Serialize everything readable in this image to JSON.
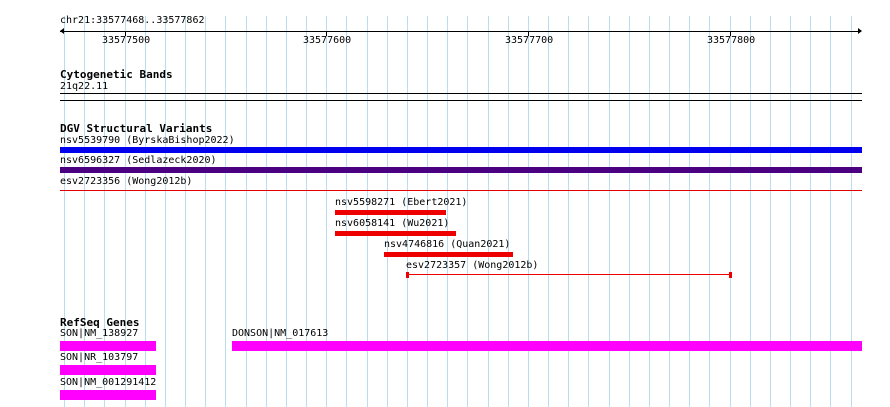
{
  "region": "chr21:33577468..33577862",
  "ruler": {
    "ticks": [
      "33577500",
      "33577600",
      "33577700",
      "33577800"
    ]
  },
  "tracks": {
    "cytoband": {
      "title": "Cytogenetic Bands",
      "band": "21q22.11"
    },
    "dgv": {
      "title": "DGV Structural Variants",
      "features": [
        {
          "label": "nsv5539790 (ByrskaBishop2022)",
          "color": "#0000ee"
        },
        {
          "label": "nsv6596327 (Sedlazeck2020)",
          "color": "#4b0082"
        },
        {
          "label": "esv2723356 (Wong2012b)",
          "color": "#e00000"
        },
        {
          "label": "nsv5598271 (Ebert2021)",
          "color": "#ee0000"
        },
        {
          "label": "nsv6058141 (Wu2021)",
          "color": "#ee0000"
        },
        {
          "label": "nsv4746816 (Quan2021)",
          "color": "#ee0000"
        },
        {
          "label": "esv2723357 (Wong2012b)",
          "color": "#ee0000"
        }
      ]
    },
    "refseq": {
      "title": "RefSeq Genes",
      "genes": [
        {
          "label": "SON|NM_138927",
          "color": "#ff00ff"
        },
        {
          "label": "SON|NR_103797",
          "color": "#ff00ff"
        },
        {
          "label": "SON|NM_001291412",
          "color": "#ff00ff"
        },
        {
          "label": "DONSON|NM_017613",
          "color": "#ff00ff"
        }
      ]
    }
  }
}
